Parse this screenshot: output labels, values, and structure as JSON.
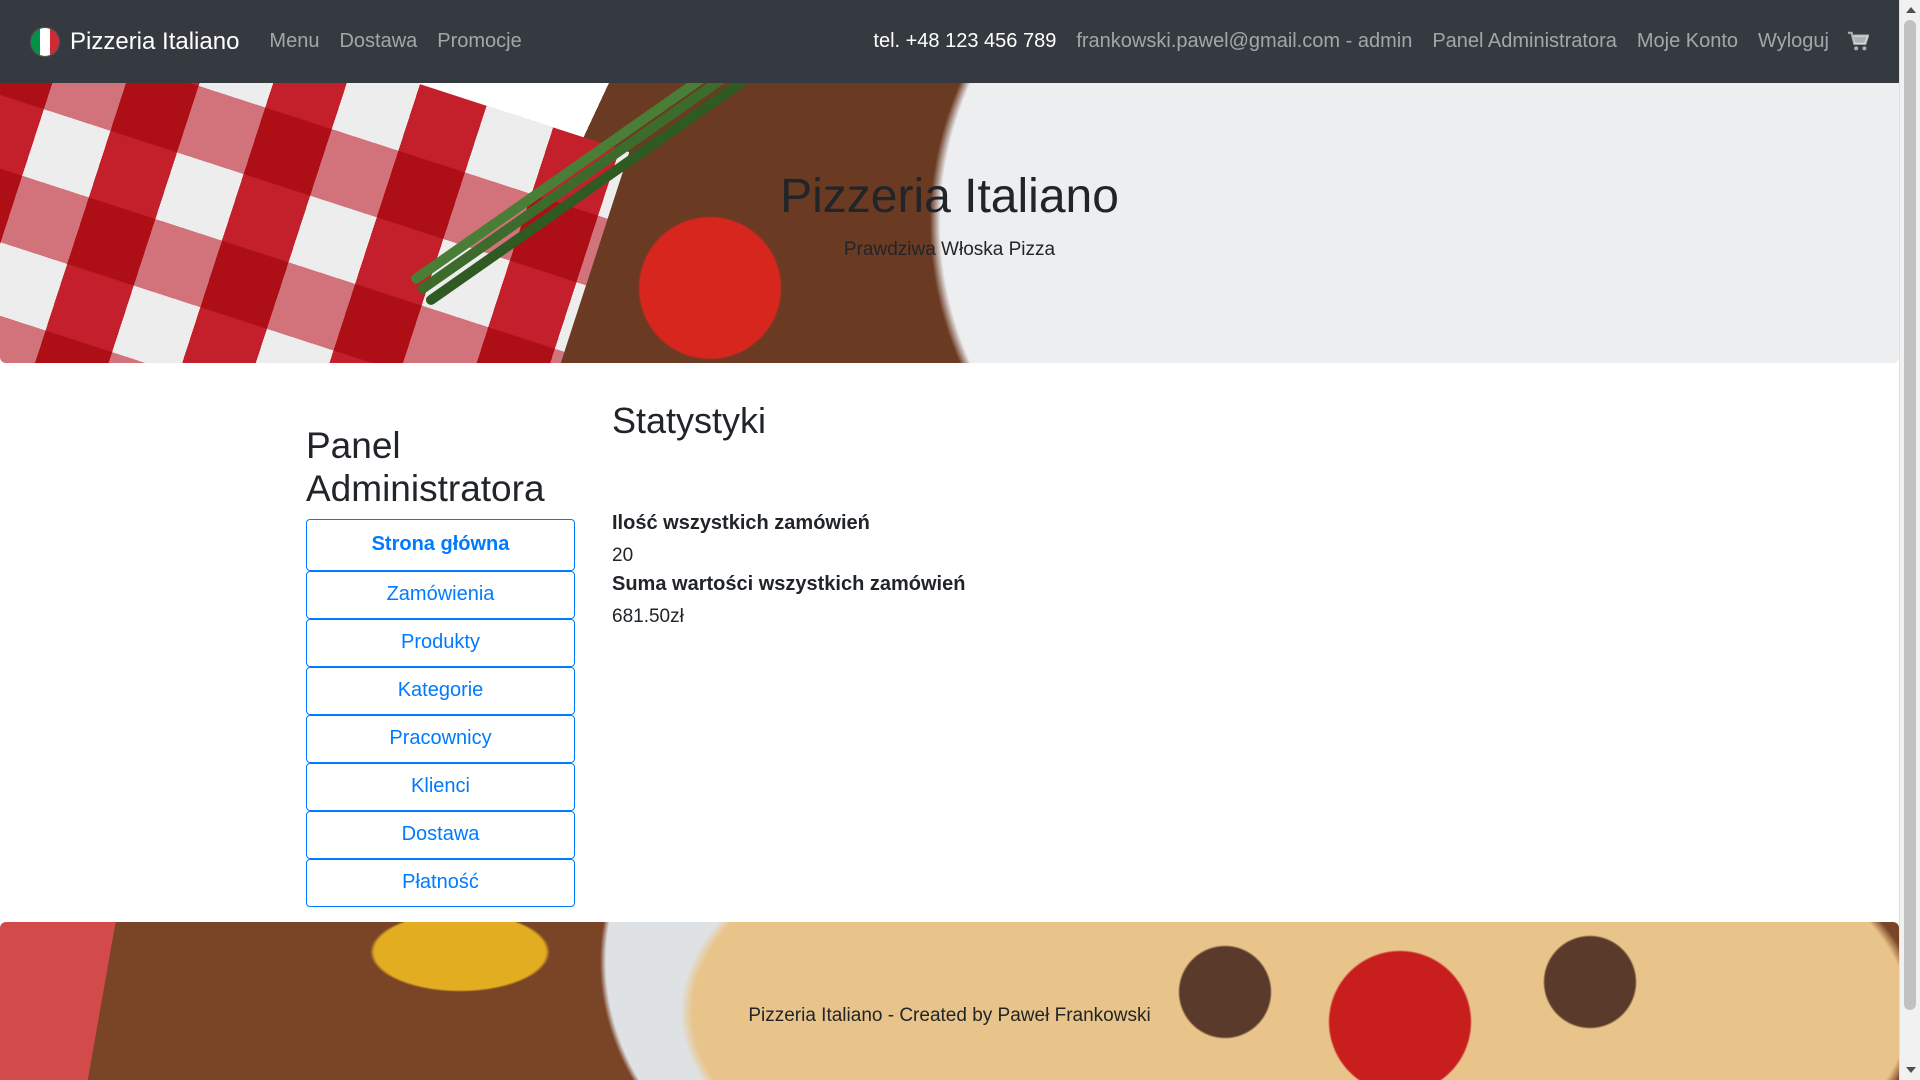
{
  "navbar": {
    "brand": "Pizzeria Italiano",
    "left_links": [
      "Menu",
      "Dostawa",
      "Promocje"
    ],
    "phone": "tel. +48 123 456 789",
    "user": "frankowski.pawel@gmail.com - admin",
    "admin_panel": "Panel Administratora",
    "account": "Moje Konto",
    "logout": "Wyloguj",
    "cart_icon": "shopping-cart-icon"
  },
  "hero": {
    "title": "Pizzeria Italiano",
    "subtitle": "Prawdziwa Włoska Pizza"
  },
  "sidebar": {
    "title": "Panel Administratora",
    "items": [
      {
        "label": "Strona główna",
        "active": true
      },
      {
        "label": "Zamówienia"
      },
      {
        "label": "Produkty"
      },
      {
        "label": "Kategorie"
      },
      {
        "label": "Pracownicy"
      },
      {
        "label": "Klienci"
      },
      {
        "label": "Dostawa"
      },
      {
        "label": "Płatność"
      }
    ]
  },
  "stats": {
    "title": "Statystyki",
    "orders_count_label": "Ilość wszystkich zamówień",
    "orders_count_value": "20",
    "orders_sum_label": "Suma wartości wszystkich zamówień",
    "orders_sum_value": "681.50zł"
  },
  "footer": {
    "text": "Pizzeria Italiano - Created by Paweł Frankowski"
  },
  "colors": {
    "navbar_bg": "#343a40",
    "link_primary": "#007bff",
    "flag_green": "#009246",
    "flag_white": "#ffffff",
    "flag_red": "#ce2b37"
  }
}
